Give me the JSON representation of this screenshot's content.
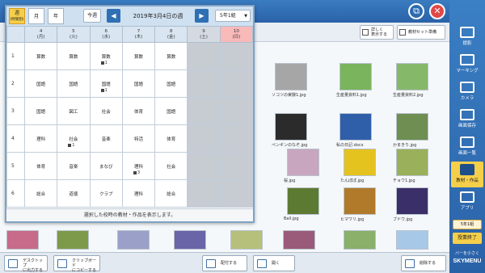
{
  "toolbar": {
    "detail_label": "詳しく\n表示する",
    "material_set_label": "教材セット準備"
  },
  "files": [
    {
      "name": "ソコツの実験1.jpg",
      "color": "#a6a6a6"
    },
    {
      "name": "生産量資料1.jpg",
      "color": "#7ab45c"
    },
    {
      "name": "生産量資料2.jpg",
      "color": "#86b86a"
    },
    {
      "name": "ペンギンのなぞ.jpg",
      "color": "#2b2b2b"
    },
    {
      "name": "私の日記.docx",
      "color": "#2f5fa8"
    },
    {
      "name": "かまきり.jpg",
      "color": "#6f8e52"
    },
    {
      "name": "桜.jpg",
      "color": "#c9a6c0"
    },
    {
      "name": "たんぽぽ.jpg",
      "color": "#e4c31f"
    },
    {
      "name": "チョウ1.jpg",
      "color": "#9ab05a"
    },
    {
      "name": "Ball.jpg",
      "color": "#5d7a33"
    },
    {
      "name": "ヒマワリ.jpg",
      "color": "#b07a2a"
    },
    {
      "name": "ブドウ.jpg",
      "color": "#3b2f6a"
    }
  ],
  "bottom": {
    "desktop_output": "デスクトップ\nに出力する",
    "clipboard_copy": "クリップボード\nにコピーする",
    "distribute": "配付する",
    "open": "開く",
    "delete": "削除する"
  },
  "sidebar": {
    "items": [
      {
        "label": "提影"
      },
      {
        "label": "マーキング"
      },
      {
        "label": "カメラ"
      },
      {
        "label": "画面保存"
      },
      {
        "label": "画面一覧"
      },
      {
        "label": "教材・作品"
      },
      {
        "label": "アプリ"
      }
    ],
    "class_label": "5年1組",
    "end_label": "授業終了",
    "brand_small": "バーを小さく",
    "brand_name": "SKYMENU"
  },
  "popup": {
    "mode_week_label": "週",
    "mode_week_sub": "(時間割)",
    "mode_month_label": "月",
    "mode_year_label": "年",
    "today_label": "今週",
    "prev_icon": "◀",
    "next_icon": "▶",
    "week_title": "2019年3月4日の週",
    "class_select": "5年1組",
    "days": [
      {
        "num": "4",
        "dow": "(月)"
      },
      {
        "num": "5",
        "dow": "(火)"
      },
      {
        "num": "6",
        "dow": "(水)"
      },
      {
        "num": "7",
        "dow": "(木)"
      },
      {
        "num": "8",
        "dow": "(金)"
      },
      {
        "num": "9",
        "dow": "(土)"
      },
      {
        "num": "10",
        "dow": "(日)"
      }
    ],
    "rows": [
      {
        "period": "1",
        "cells": [
          {
            "s": "算数"
          },
          {
            "s": "算数"
          },
          {
            "s": "算数",
            "b": "1"
          },
          {
            "s": "算数"
          },
          {
            "s": "算数"
          }
        ]
      },
      {
        "period": "2",
        "cells": [
          {
            "s": "国語"
          },
          {
            "s": "国語"
          },
          {
            "s": "国語",
            "b": "1"
          },
          {
            "s": "国語"
          },
          {
            "s": "国語"
          }
        ]
      },
      {
        "period": "3",
        "cells": [
          {
            "s": "国語"
          },
          {
            "s": "図工"
          },
          {
            "s": "社会"
          },
          {
            "s": "体育"
          },
          {
            "s": "国語"
          }
        ]
      },
      {
        "period": "4",
        "cells": [
          {
            "s": "理科"
          },
          {
            "s": "社会",
            "b": "1"
          },
          {
            "s": "音楽"
          },
          {
            "s": "特活"
          },
          {
            "s": "体育"
          }
        ]
      },
      {
        "period": "5",
        "cells": [
          {
            "s": "体育"
          },
          {
            "s": "音楽"
          },
          {
            "s": "まなび"
          },
          {
            "s": "理科",
            "b": "3"
          },
          {
            "s": "社会"
          }
        ]
      },
      {
        "period": "6",
        "cells": [
          {
            "s": "総合"
          },
          {
            "s": "道徳"
          },
          {
            "s": "クラブ"
          },
          {
            "s": "理科"
          },
          {
            "s": "総合"
          }
        ]
      }
    ],
    "footer": "選択した校時の教材・作品を表示します。"
  }
}
